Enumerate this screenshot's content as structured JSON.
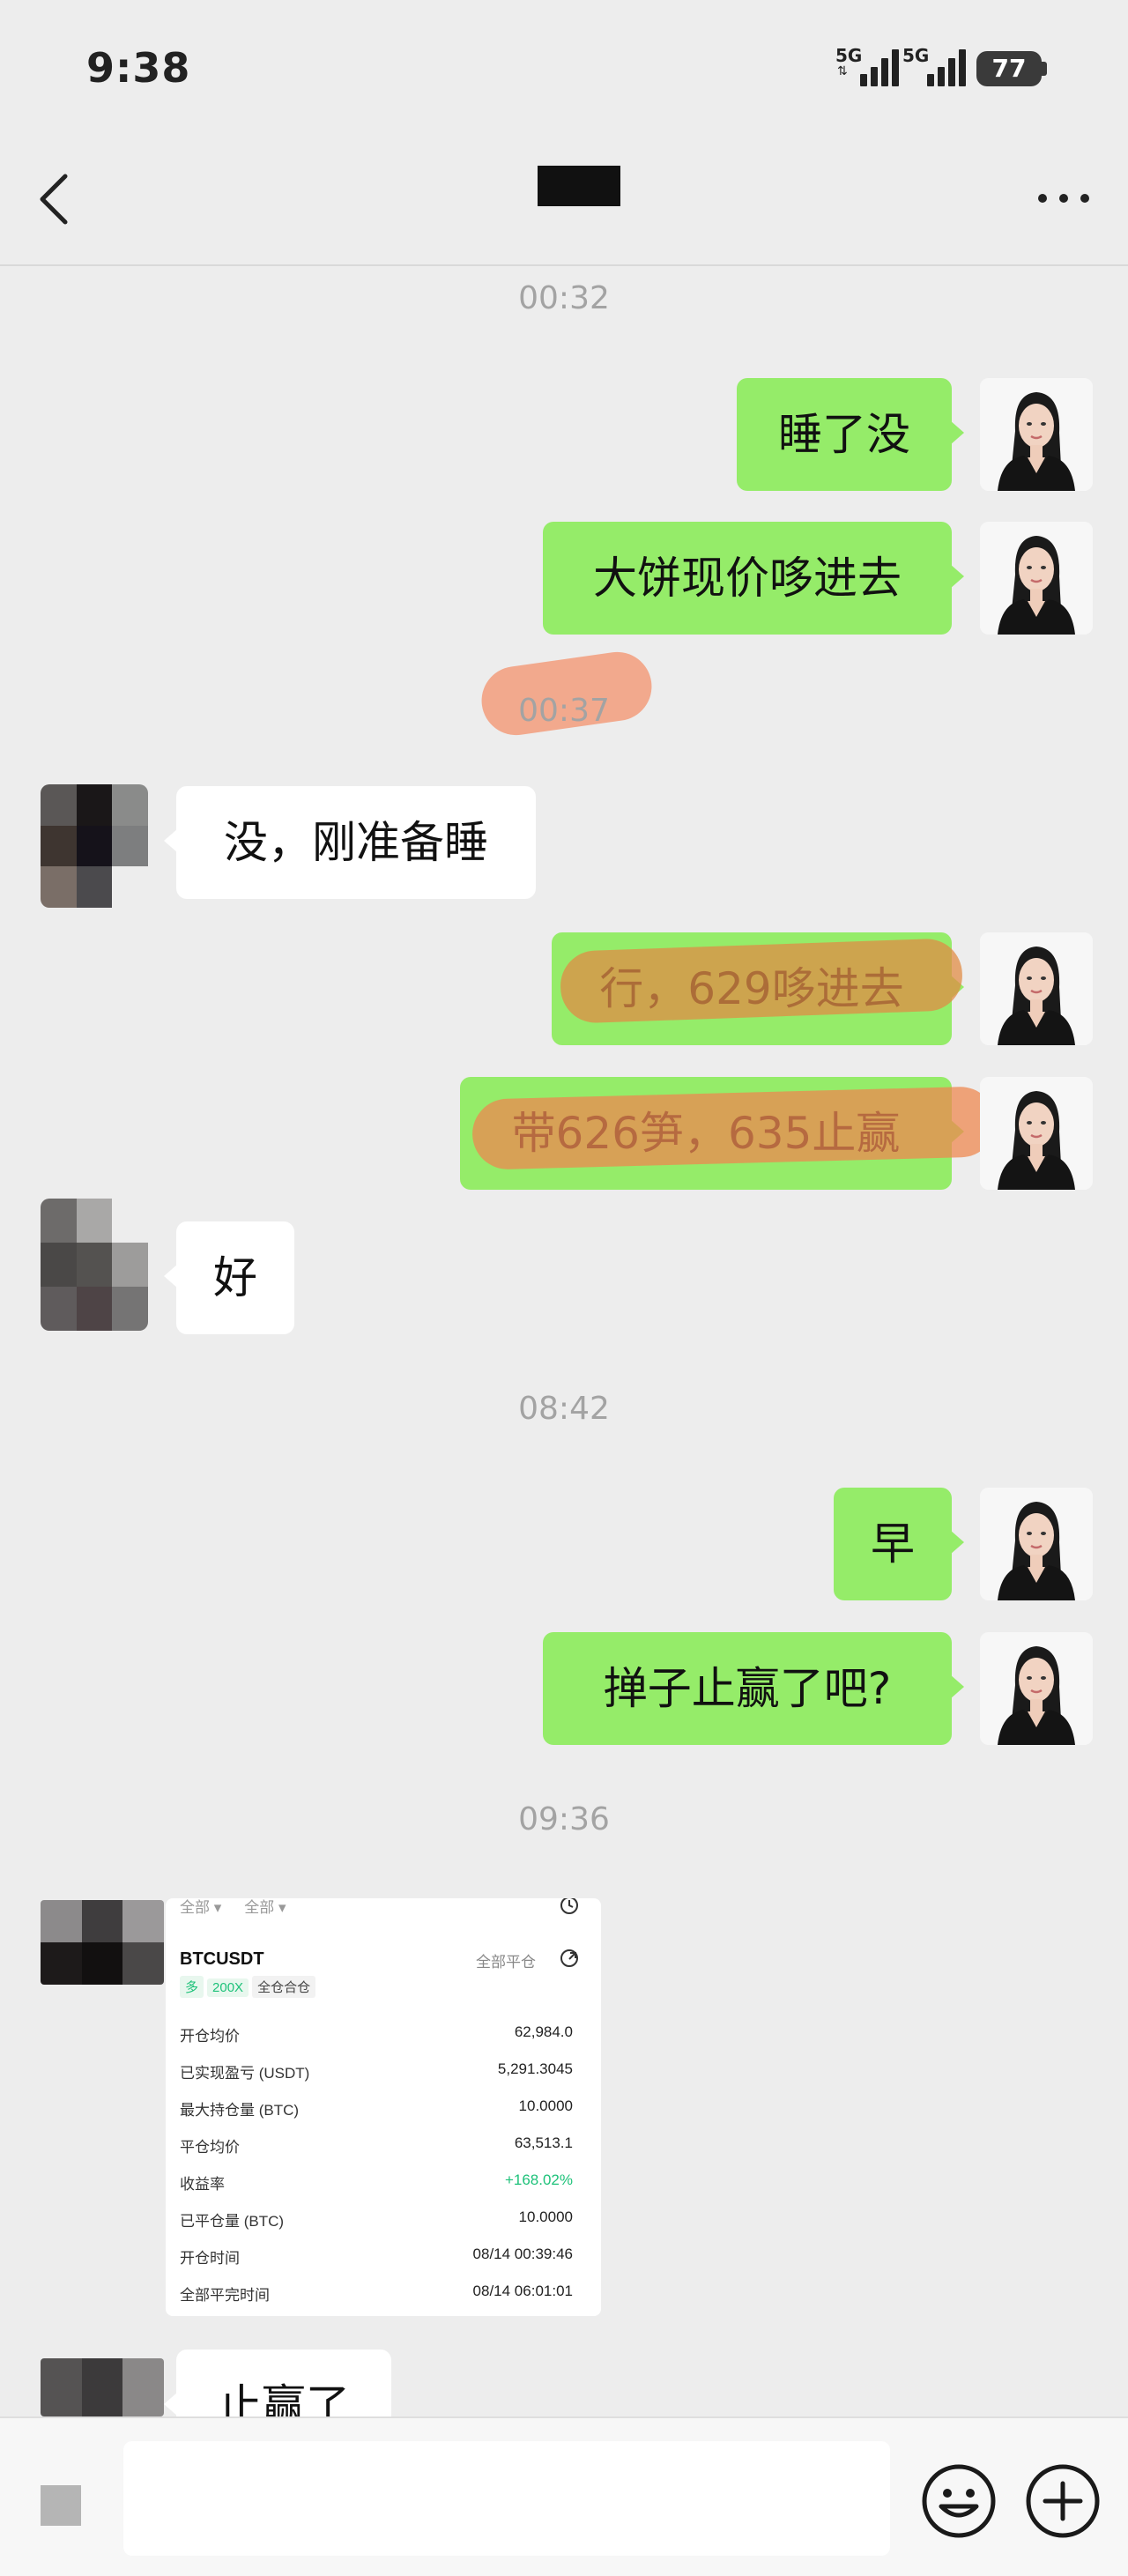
{
  "status_bar": {
    "time": "9:38",
    "signal1_label": "5G",
    "signal2_label": "5G",
    "battery": "77"
  },
  "nav": {
    "title": "",
    "back_icon": "chevron-left-icon",
    "more_icon": "more-dots-icon"
  },
  "messages": {
    "ts1": "00:32",
    "m1": "睡了没",
    "m2": "大饼现价哆进去",
    "ts2": "00:37",
    "m3": "没，刚准备睡",
    "m4": "行，629哆进去",
    "m5": "带626笋，635止赢",
    "m6": "好",
    "ts3": "08:42",
    "m7": "早",
    "m8": "掸子止赢了吧?",
    "ts4": "09:36",
    "m9": "止赢了"
  },
  "trade_card": {
    "filters": [
      "全部 ▾",
      "全部 ▾"
    ],
    "symbol": "BTCUSDT",
    "close_all": "全部平仓",
    "tags": {
      "side": "多",
      "leverage": "200X",
      "mode": "全仓合仓"
    },
    "rows": [
      {
        "k": "开仓均价",
        "v": "62,984.0"
      },
      {
        "k": "已实现盈亏 (USDT)",
        "v": "5,291.3045"
      },
      {
        "k": "最大持仓量 (BTC)",
        "v": "10.0000"
      },
      {
        "k": "平仓均价",
        "v": "63,513.1"
      },
      {
        "k": "收益率",
        "v": "+168.02%"
      },
      {
        "k": "已平仓量 (BTC)",
        "v": "10.0000"
      },
      {
        "k": "开仓时间",
        "v": "08/14 00:39:46"
      },
      {
        "k": "全部平完时间",
        "v": "08/14 06:01:01"
      }
    ]
  },
  "input_bar": {
    "placeholder": "",
    "emoji_icon": "smiley-icon",
    "plus_icon": "plus-circle-icon"
  },
  "colors": {
    "my_bubble": "#95ec69",
    "their_bubble": "#ffffff",
    "background": "#ededed",
    "positive": "#1ec27a",
    "highlight": "#f0936a"
  }
}
